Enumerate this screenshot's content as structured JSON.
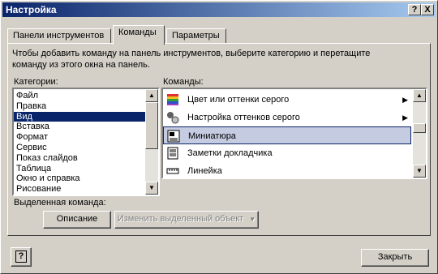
{
  "window": {
    "title": "Настройка",
    "help_btn": "?",
    "close_btn": "X"
  },
  "tabs": [
    {
      "label": "Панели инструментов"
    },
    {
      "label": "Команды"
    },
    {
      "label": "Параметры"
    }
  ],
  "instructions": "Чтобы добавить команду на панель инструментов, выберите категорию и перетащите команду из этого окна на панель.",
  "categories_label": "Категории:",
  "commands_label": "Команды:",
  "categories": [
    "Файл",
    "Правка",
    "Вид",
    "Вставка",
    "Формат",
    "Сервис",
    "Показ слайдов",
    "Таблица",
    "Окно и справка",
    "Рисование"
  ],
  "selected_category": "Вид",
  "commands": [
    {
      "label": "Цвет или оттенки серого",
      "icon": "color-palette-icon",
      "submenu": true
    },
    {
      "label": "Настройка оттенков серого",
      "icon": "grayscale-settings-icon",
      "submenu": true
    },
    {
      "label": "Миниатюра",
      "icon": "thumbnail-icon",
      "submenu": false,
      "selected": true
    },
    {
      "label": "Заметки докладчика",
      "icon": "speaker-notes-icon",
      "submenu": false
    },
    {
      "label": "Линейка",
      "icon": "ruler-icon",
      "submenu": false
    }
  ],
  "selected_command_label": "Выделенная команда:",
  "description_btn": "Описание",
  "modify_btn": "Изменить выделенный объект",
  "close_button": "Закрыть",
  "help_icon_btn": "?"
}
